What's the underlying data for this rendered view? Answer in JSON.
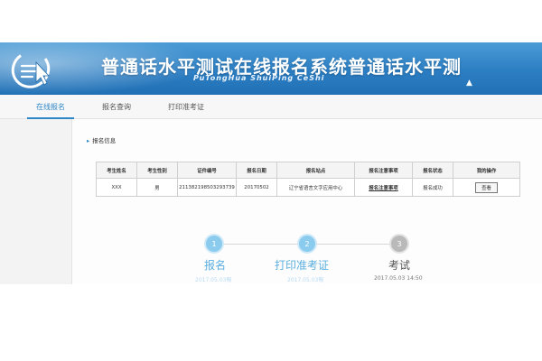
{
  "header": {
    "title": "普通话水平测试在线报名系统普通话水平测",
    "subtitle": "PuTongHua ShuiPing CeShi",
    "logo_icon": "mouse-arrow-logo-icon",
    "colors": {
      "banner": "#2c7ec3",
      "accent": "#2f87c8"
    }
  },
  "nav": {
    "items": [
      {
        "label": "在线报名",
        "active": true
      },
      {
        "label": "报名查询",
        "active": false
      },
      {
        "label": "打印准考证",
        "active": false
      }
    ]
  },
  "section": {
    "title": "报名信息",
    "icon": "arrow-bullet-icon"
  },
  "table": {
    "headers": [
      "考生姓名",
      "考生性别",
      "证件编号",
      "报名日期",
      "报名站点",
      "报名注意事项",
      "报名状态",
      "我的操作"
    ],
    "rows": [
      {
        "name": "XXX",
        "gender": "男",
        "id_number": "211382198503293739",
        "date": "20170502",
        "site": "辽宁省语言文字应用中心",
        "notes": "报名注意事项",
        "status": "报名成功",
        "action": "查看"
      }
    ]
  },
  "steps": [
    {
      "number": "1",
      "label": "报名",
      "date": "2017.05.03報",
      "state": "done"
    },
    {
      "number": "2",
      "label": "打印准考证",
      "date": "2017.05.03報",
      "state": "done"
    },
    {
      "number": "3",
      "label": "考试",
      "date": "2017.05.03 14:50",
      "state": "todo"
    }
  ]
}
